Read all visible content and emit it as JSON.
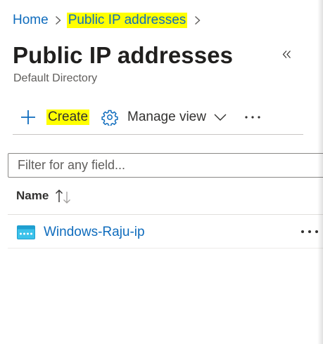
{
  "breadcrumb": {
    "items": [
      {
        "label": "Home"
      },
      {
        "label": "Public IP addresses"
      }
    ]
  },
  "header": {
    "title": "Public IP addresses",
    "subtitle": "Default Directory"
  },
  "toolbar": {
    "create_label": "Create",
    "manage_view_label": "Manage view"
  },
  "filter": {
    "placeholder": "Filter for any field..."
  },
  "table": {
    "columns": [
      {
        "label": "Name",
        "sort_icon": "sort-ascending-icon"
      }
    ],
    "rows": [
      {
        "name": "Windows-Raju-ip",
        "icon": "public-ip-icon"
      }
    ]
  },
  "colors": {
    "link": "#0f6cbd",
    "highlight": "#ffff00",
    "resource_icon": "#3cc2ea"
  }
}
